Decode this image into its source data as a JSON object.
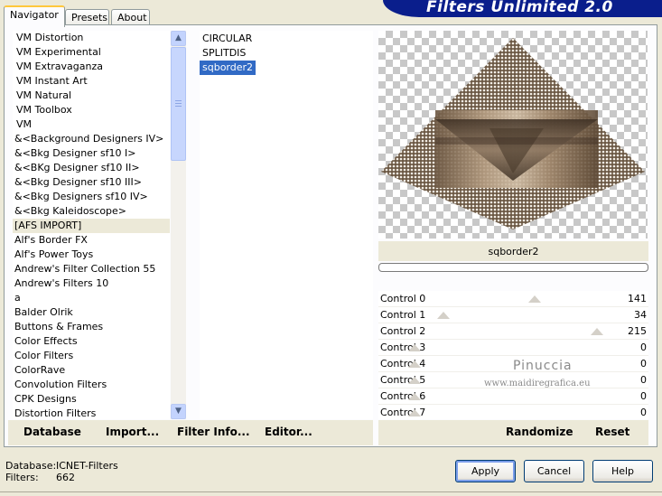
{
  "app": {
    "title": "Filters Unlimited 2.0"
  },
  "tabs": [
    {
      "label": "Navigator",
      "active": true
    },
    {
      "label": "Presets",
      "active": false
    },
    {
      "label": "About",
      "active": false
    }
  ],
  "categories": [
    "VM Distortion",
    "VM Experimental",
    "VM Extravaganza",
    "VM Instant Art",
    "VM Natural",
    "VM Toolbox",
    "VM",
    "&<Background Designers IV>",
    "&<Bkg Designer sf10 I>",
    "&<BKg Designer sf10 II>",
    "&<Bkg Designer sf10 III>",
    "&<Bkg Designers sf10 IV>",
    "&<Bkg Kaleidoscope>",
    "[AFS IMPORT]",
    "Alf's Border FX",
    "Alf's Power Toys",
    "Andrew's Filter Collection 55",
    "Andrew's Filters 10",
    "a",
    "Balder Olrik",
    "Buttons & Frames",
    "Color Effects",
    "Color Filters",
    "ColorRave",
    "Convolution Filters",
    "CPK Designs",
    "Distortion Filters"
  ],
  "selected_category": "[AFS IMPORT]",
  "filters": [
    "CIRCULAR",
    "SPLITDIS",
    "sqborder2"
  ],
  "selected_filter": "sqborder2",
  "left_toolbar": {
    "database": "Database",
    "import": "Import...",
    "filter_info": "Filter Info...",
    "editor": "Editor..."
  },
  "filter_name": "sqborder2",
  "progress": 0,
  "controls": [
    {
      "label": "Control 0",
      "value": 141
    },
    {
      "label": "Control 1",
      "value": 34
    },
    {
      "label": "Control 2",
      "value": 215
    },
    {
      "label": "Control 3",
      "value": 0
    },
    {
      "label": "Control 4",
      "value": 0
    },
    {
      "label": "Control 5",
      "value": 0
    },
    {
      "label": "Control 6",
      "value": 0
    },
    {
      "label": "Control 7",
      "value": 0
    }
  ],
  "right_toolbar": {
    "randomize": "Randomize",
    "reset": "Reset"
  },
  "watermark": {
    "name": "Pinuccia",
    "url": "www.maidiregrafica.eu"
  },
  "status": {
    "database_label": "Database:",
    "database_value": "ICNET-Filters",
    "filters_label": "Filters:",
    "filters_value": "662"
  },
  "buttons": {
    "apply": "Apply",
    "cancel": "Cancel",
    "help": "Help"
  },
  "scrollbar": {
    "up_icon": "arrow-up-icon",
    "down_icon": "arrow-down-icon"
  },
  "colors": {
    "banner": "#0A1E8C",
    "selection": "#316AC5",
    "tab_highlight": "#FFC83C"
  }
}
